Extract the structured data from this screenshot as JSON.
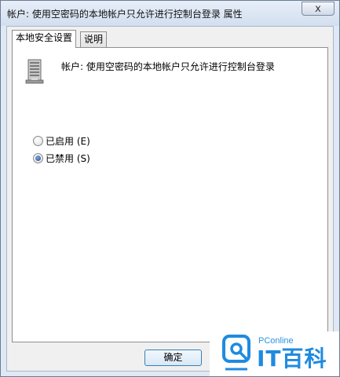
{
  "window": {
    "title": "帐户: 使用空密码的本地帐户只允许进行控制台登录 属性",
    "close_glyph": "x"
  },
  "tabs": [
    {
      "label": "本地安全设置",
      "active": true
    },
    {
      "label": "说明",
      "active": false
    }
  ],
  "policy": {
    "icon": "server-icon",
    "title": "帐户: 使用空密码的本地帐户只允许进行控制台登录"
  },
  "options": [
    {
      "label": "已启用 (E)",
      "checked": false
    },
    {
      "label": "已禁用 (S)",
      "checked": true
    }
  ],
  "buttons": {
    "ok_label": "确定"
  },
  "watermark": {
    "small": "PConline",
    "big": "IT百科",
    "icon": "pconline-logo"
  },
  "colors": {
    "accent": "#1f8be0",
    "radio_selected": "#1f4f9a"
  }
}
